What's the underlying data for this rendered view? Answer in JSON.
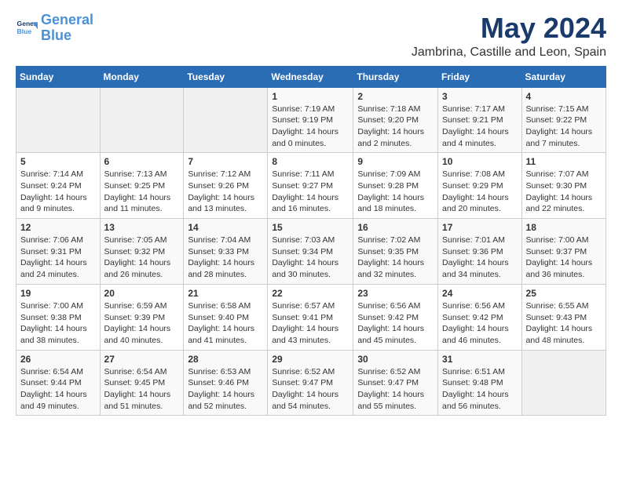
{
  "header": {
    "logo_line1": "General",
    "logo_line2": "Blue",
    "title": "May 2024",
    "subtitle": "Jambrina, Castille and Leon, Spain"
  },
  "calendar": {
    "weekdays": [
      "Sunday",
      "Monday",
      "Tuesday",
      "Wednesday",
      "Thursday",
      "Friday",
      "Saturday"
    ],
    "weeks": [
      [
        {
          "day": "",
          "content": ""
        },
        {
          "day": "",
          "content": ""
        },
        {
          "day": "",
          "content": ""
        },
        {
          "day": "1",
          "content": "Sunrise: 7:19 AM\nSunset: 9:19 PM\nDaylight: 14 hours and 0 minutes."
        },
        {
          "day": "2",
          "content": "Sunrise: 7:18 AM\nSunset: 9:20 PM\nDaylight: 14 hours and 2 minutes."
        },
        {
          "day": "3",
          "content": "Sunrise: 7:17 AM\nSunset: 9:21 PM\nDaylight: 14 hours and 4 minutes."
        },
        {
          "day": "4",
          "content": "Sunrise: 7:15 AM\nSunset: 9:22 PM\nDaylight: 14 hours and 7 minutes."
        }
      ],
      [
        {
          "day": "5",
          "content": "Sunrise: 7:14 AM\nSunset: 9:24 PM\nDaylight: 14 hours and 9 minutes."
        },
        {
          "day": "6",
          "content": "Sunrise: 7:13 AM\nSunset: 9:25 PM\nDaylight: 14 hours and 11 minutes."
        },
        {
          "day": "7",
          "content": "Sunrise: 7:12 AM\nSunset: 9:26 PM\nDaylight: 14 hours and 13 minutes."
        },
        {
          "day": "8",
          "content": "Sunrise: 7:11 AM\nSunset: 9:27 PM\nDaylight: 14 hours and 16 minutes."
        },
        {
          "day": "9",
          "content": "Sunrise: 7:09 AM\nSunset: 9:28 PM\nDaylight: 14 hours and 18 minutes."
        },
        {
          "day": "10",
          "content": "Sunrise: 7:08 AM\nSunset: 9:29 PM\nDaylight: 14 hours and 20 minutes."
        },
        {
          "day": "11",
          "content": "Sunrise: 7:07 AM\nSunset: 9:30 PM\nDaylight: 14 hours and 22 minutes."
        }
      ],
      [
        {
          "day": "12",
          "content": "Sunrise: 7:06 AM\nSunset: 9:31 PM\nDaylight: 14 hours and 24 minutes."
        },
        {
          "day": "13",
          "content": "Sunrise: 7:05 AM\nSunset: 9:32 PM\nDaylight: 14 hours and 26 minutes."
        },
        {
          "day": "14",
          "content": "Sunrise: 7:04 AM\nSunset: 9:33 PM\nDaylight: 14 hours and 28 minutes."
        },
        {
          "day": "15",
          "content": "Sunrise: 7:03 AM\nSunset: 9:34 PM\nDaylight: 14 hours and 30 minutes."
        },
        {
          "day": "16",
          "content": "Sunrise: 7:02 AM\nSunset: 9:35 PM\nDaylight: 14 hours and 32 minutes."
        },
        {
          "day": "17",
          "content": "Sunrise: 7:01 AM\nSunset: 9:36 PM\nDaylight: 14 hours and 34 minutes."
        },
        {
          "day": "18",
          "content": "Sunrise: 7:00 AM\nSunset: 9:37 PM\nDaylight: 14 hours and 36 minutes."
        }
      ],
      [
        {
          "day": "19",
          "content": "Sunrise: 7:00 AM\nSunset: 9:38 PM\nDaylight: 14 hours and 38 minutes."
        },
        {
          "day": "20",
          "content": "Sunrise: 6:59 AM\nSunset: 9:39 PM\nDaylight: 14 hours and 40 minutes."
        },
        {
          "day": "21",
          "content": "Sunrise: 6:58 AM\nSunset: 9:40 PM\nDaylight: 14 hours and 41 minutes."
        },
        {
          "day": "22",
          "content": "Sunrise: 6:57 AM\nSunset: 9:41 PM\nDaylight: 14 hours and 43 minutes."
        },
        {
          "day": "23",
          "content": "Sunrise: 6:56 AM\nSunset: 9:42 PM\nDaylight: 14 hours and 45 minutes."
        },
        {
          "day": "24",
          "content": "Sunrise: 6:56 AM\nSunset: 9:42 PM\nDaylight: 14 hours and 46 minutes."
        },
        {
          "day": "25",
          "content": "Sunrise: 6:55 AM\nSunset: 9:43 PM\nDaylight: 14 hours and 48 minutes."
        }
      ],
      [
        {
          "day": "26",
          "content": "Sunrise: 6:54 AM\nSunset: 9:44 PM\nDaylight: 14 hours and 49 minutes."
        },
        {
          "day": "27",
          "content": "Sunrise: 6:54 AM\nSunset: 9:45 PM\nDaylight: 14 hours and 51 minutes."
        },
        {
          "day": "28",
          "content": "Sunrise: 6:53 AM\nSunset: 9:46 PM\nDaylight: 14 hours and 52 minutes."
        },
        {
          "day": "29",
          "content": "Sunrise: 6:52 AM\nSunset: 9:47 PM\nDaylight: 14 hours and 54 minutes."
        },
        {
          "day": "30",
          "content": "Sunrise: 6:52 AM\nSunset: 9:47 PM\nDaylight: 14 hours and 55 minutes."
        },
        {
          "day": "31",
          "content": "Sunrise: 6:51 AM\nSunset: 9:48 PM\nDaylight: 14 hours and 56 minutes."
        },
        {
          "day": "",
          "content": ""
        }
      ]
    ]
  }
}
